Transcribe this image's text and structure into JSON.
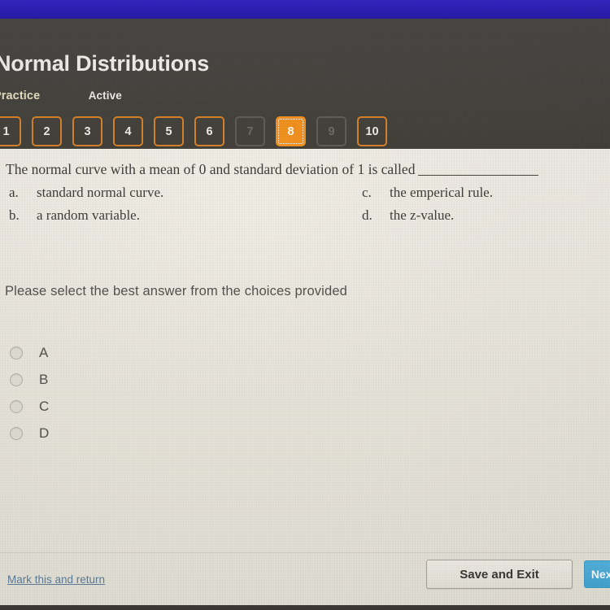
{
  "window": {
    "browser_bar_color": "#2d20b9",
    "header_bg_color": "#474541",
    "content_bg_color": "#edeae1",
    "bottom_strip_color": "#3d3b37"
  },
  "header": {
    "lesson_title": "Normal Distributions",
    "crumb_practice": "Practice",
    "crumb_active": "Active",
    "accent_color": "#f3921f",
    "question_nav": [
      {
        "label": "1",
        "state": "done"
      },
      {
        "label": "2",
        "state": "done"
      },
      {
        "label": "3",
        "state": "done"
      },
      {
        "label": "4",
        "state": "done"
      },
      {
        "label": "5",
        "state": "done"
      },
      {
        "label": "6",
        "state": "done"
      },
      {
        "label": "7",
        "state": "disabled"
      },
      {
        "label": "8",
        "state": "current"
      },
      {
        "label": "9",
        "state": "disabled"
      },
      {
        "label": "10",
        "state": "done"
      }
    ]
  },
  "question": {
    "stem_before_blank": "The normal curve with a mean of 0 and standard deviation of 1 is called",
    "choices": [
      {
        "letter": "a.",
        "text": "standard normal curve."
      },
      {
        "letter": "b.",
        "text": "a random variable."
      },
      {
        "letter": "c.",
        "text": "the emperical rule."
      },
      {
        "letter": "d.",
        "text": "the z-value."
      }
    ]
  },
  "instruction": "Please select the best answer from the choices provided",
  "answers": {
    "options": [
      {
        "label": "A",
        "selected": false
      },
      {
        "label": "B",
        "selected": false
      },
      {
        "label": "C",
        "selected": false
      },
      {
        "label": "D",
        "selected": false
      }
    ]
  },
  "footer": {
    "mark_link": "Mark this and return",
    "save_button": "Save and Exit",
    "next_button": "Next",
    "link_color": "#5d7f9c",
    "next_button_color": "#4aaedd"
  }
}
